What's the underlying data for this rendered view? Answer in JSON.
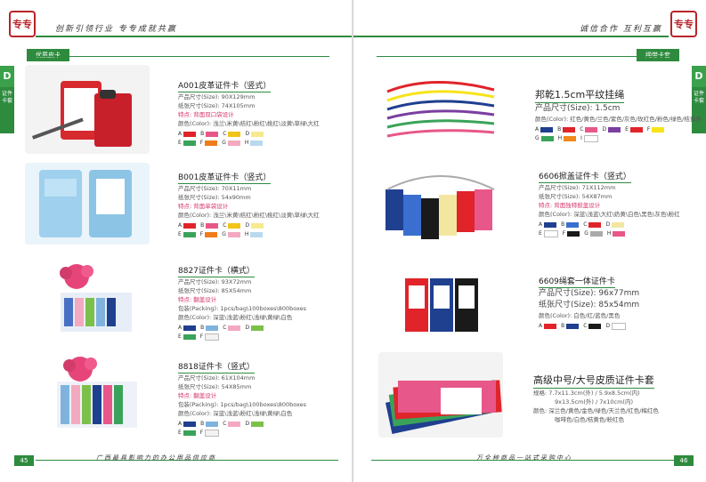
{
  "left": {
    "header_slogan": "创新引领行业  专专成就共赢",
    "seal_text": "专专",
    "category": "优质皮卡",
    "side_tab_letter": "D",
    "side_tab_text": "证件卡套",
    "page_number": "45",
    "footer_slogan": "广西最具影响力的办公用品供应商",
    "products": [
      {
        "title": "A001皮革证件卡（竖式）",
        "lines": [
          "产品尺寸(Size): 90X129mm",
          "纸张尺寸(Size): 74X105mm"
        ],
        "feature": "特点: 背面双口袋设计",
        "colors_text": "颜色(Color): 浅兰\\米黄\\桔红\\粉红\\桃红\\淡黄\\草绿\\大红",
        "swatches": [
          {
            "label": "A",
            "color": "#e0242a"
          },
          {
            "label": "B",
            "color": "#e8578a"
          },
          {
            "label": "C",
            "color": "#f0c419"
          },
          {
            "label": "D",
            "color": "#f7e98f"
          },
          {
            "label": "E",
            "color": "#3aa35a"
          },
          {
            "label": "F",
            "color": "#ef7c1a"
          },
          {
            "label": "G",
            "color": "#f3a9c0"
          },
          {
            "label": "H",
            "color": "#b9d9ee"
          }
        ]
      },
      {
        "title": "B001皮革证件卡（竖式）",
        "lines": [
          "产品尺寸(Size): 70X11mm",
          "纸张尺寸(Size): 54x90mm"
        ],
        "feature": "特点: 背面单袋设计",
        "colors_text": "颜色(Color): 浅兰\\米黄\\桔红\\粉红\\桃红\\淡黄\\草绿\\大红",
        "swatches": [
          {
            "label": "A",
            "color": "#e0242a"
          },
          {
            "label": "B",
            "color": "#e8578a"
          },
          {
            "label": "C",
            "color": "#f0c419"
          },
          {
            "label": "D",
            "color": "#f7e98f"
          },
          {
            "label": "E",
            "color": "#3aa35a"
          },
          {
            "label": "F",
            "color": "#ef7c1a"
          },
          {
            "label": "G",
            "color": "#f3a9c0"
          },
          {
            "label": "H",
            "color": "#b9d9ee"
          }
        ]
      },
      {
        "title": "8827证件卡（横式）",
        "lines": [
          "产品尺寸(Size): 93X72mm",
          "纸张尺寸(Size): 85X54mm"
        ],
        "feature": "特点: 翻盖设计",
        "extra": "包装(Packing): 1pcs/bag\\100boxes\\800boxes",
        "colors_text": "颜色(Color): 深蓝\\浅蓝\\粉红\\浅绿\\黄绿\\白色",
        "swatches": [
          {
            "label": "A",
            "color": "#1f3f8f"
          },
          {
            "label": "B",
            "color": "#7fb3de"
          },
          {
            "label": "C",
            "color": "#f3a9c0"
          },
          {
            "label": "D",
            "color": "#7cc04b"
          },
          {
            "label": "E",
            "color": "#3aa35a"
          },
          {
            "label": "F",
            "color": "#f2f2f2"
          }
        ]
      },
      {
        "title": "8818证件卡（竖式）",
        "lines": [
          "产品尺寸(Size): 61X104mm",
          "纸张尺寸(Size): 54X85mm"
        ],
        "feature": "特点: 翻盖设计",
        "extra": "包装(Packing): 1pcs/bag\\100boxes\\800boxes",
        "colors_text": "颜色(Color): 深蓝\\浅蓝\\粉红\\浅绿\\黄绿\\白色",
        "swatches": [
          {
            "label": "A",
            "color": "#1f3f8f"
          },
          {
            "label": "B",
            "color": "#7fb3de"
          },
          {
            "label": "C",
            "color": "#f3a9c0"
          },
          {
            "label": "D",
            "color": "#7cc04b"
          },
          {
            "label": "E",
            "color": "#3aa35a"
          },
          {
            "label": "F",
            "color": "#f2f2f2"
          }
        ]
      }
    ]
  },
  "right": {
    "header_slogan": "诚信合作  互利互赢",
    "seal_text": "专专",
    "category": "绳带卡套",
    "side_tab_letter": "D",
    "side_tab_text": "证件卡套",
    "page_number": "46",
    "footer_slogan": "万全种商品一站式采购中心",
    "products": [
      {
        "title": "邦乾1.5cm平纹挂绳",
        "lines": [
          "产品尺寸(Size): 1.5cm"
        ],
        "colors_text": "颜色(Color): 红色/黄色/兰色/紫色/灰色/玫红色/粉色/绿色/桔黄色",
        "swatches": [
          {
            "label": "A",
            "color": "#1f3f8f"
          },
          {
            "label": "B",
            "color": "#e0242a"
          },
          {
            "label": "C",
            "color": "#e8578a"
          },
          {
            "label": "D",
            "color": "#7a3fa0"
          },
          {
            "label": "E",
            "color": "#e0242a"
          },
          {
            "label": "F",
            "color": "#f7e31a"
          },
          {
            "label": "G",
            "color": "#3aa35a"
          },
          {
            "label": "H",
            "color": "#f08a1a"
          },
          {
            "label": "I",
            "color": "#ffffff"
          }
        ]
      },
      {
        "title": "6606掀盖证件卡（竖式）",
        "lines": [
          "产品尺寸(Size): 71X112mm",
          "纸张尺寸(Size): 54X87mm"
        ],
        "feature": "特点: 背面独特掀盖设计",
        "colors_text": "颜色(Color): 深蓝\\浅蓝\\大红\\奶黄\\白色\\黑色\\灰色\\粉红",
        "swatches": [
          {
            "label": "A",
            "color": "#1f3f8f"
          },
          {
            "label": "B",
            "color": "#3a6fd0"
          },
          {
            "label": "C",
            "color": "#e0242a"
          },
          {
            "label": "D",
            "color": "#f3e6a0"
          },
          {
            "label": "E",
            "color": "#ffffff"
          },
          {
            "label": "F",
            "color": "#1a1a1a"
          },
          {
            "label": "G",
            "color": "#aaaaaa"
          },
          {
            "label": "H",
            "color": "#e8578a"
          }
        ]
      },
      {
        "title": "6609绳套一体证件卡",
        "lines": [
          "产品尺寸(Size): 96x77mm",
          "纸张尺寸(Size): 85x54mm"
        ],
        "colors_text": "颜色(Color): 白色/红/蓝色/黑色",
        "swatches": [
          {
            "label": "A",
            "color": "#e0242a"
          },
          {
            "label": "B",
            "color": "#1f3f8f"
          },
          {
            "label": "C",
            "color": "#1a1a1a"
          },
          {
            "label": "D",
            "color": "#ffffff"
          }
        ]
      },
      {
        "title": "高级中号/大号皮质证件卡套",
        "lines": [
          "规格: 7.7x11.3cm(外) / 5.9x8.5cm(内)",
          "9x13.5cm(外) / 7x10cm(内)"
        ],
        "colors_text": "颜色: 深兰色/黄色/金色/绿色/天兰色/红色/梅红色",
        "colors_text2": "咖啡色/白色/桔黄色/粉红色"
      }
    ]
  }
}
